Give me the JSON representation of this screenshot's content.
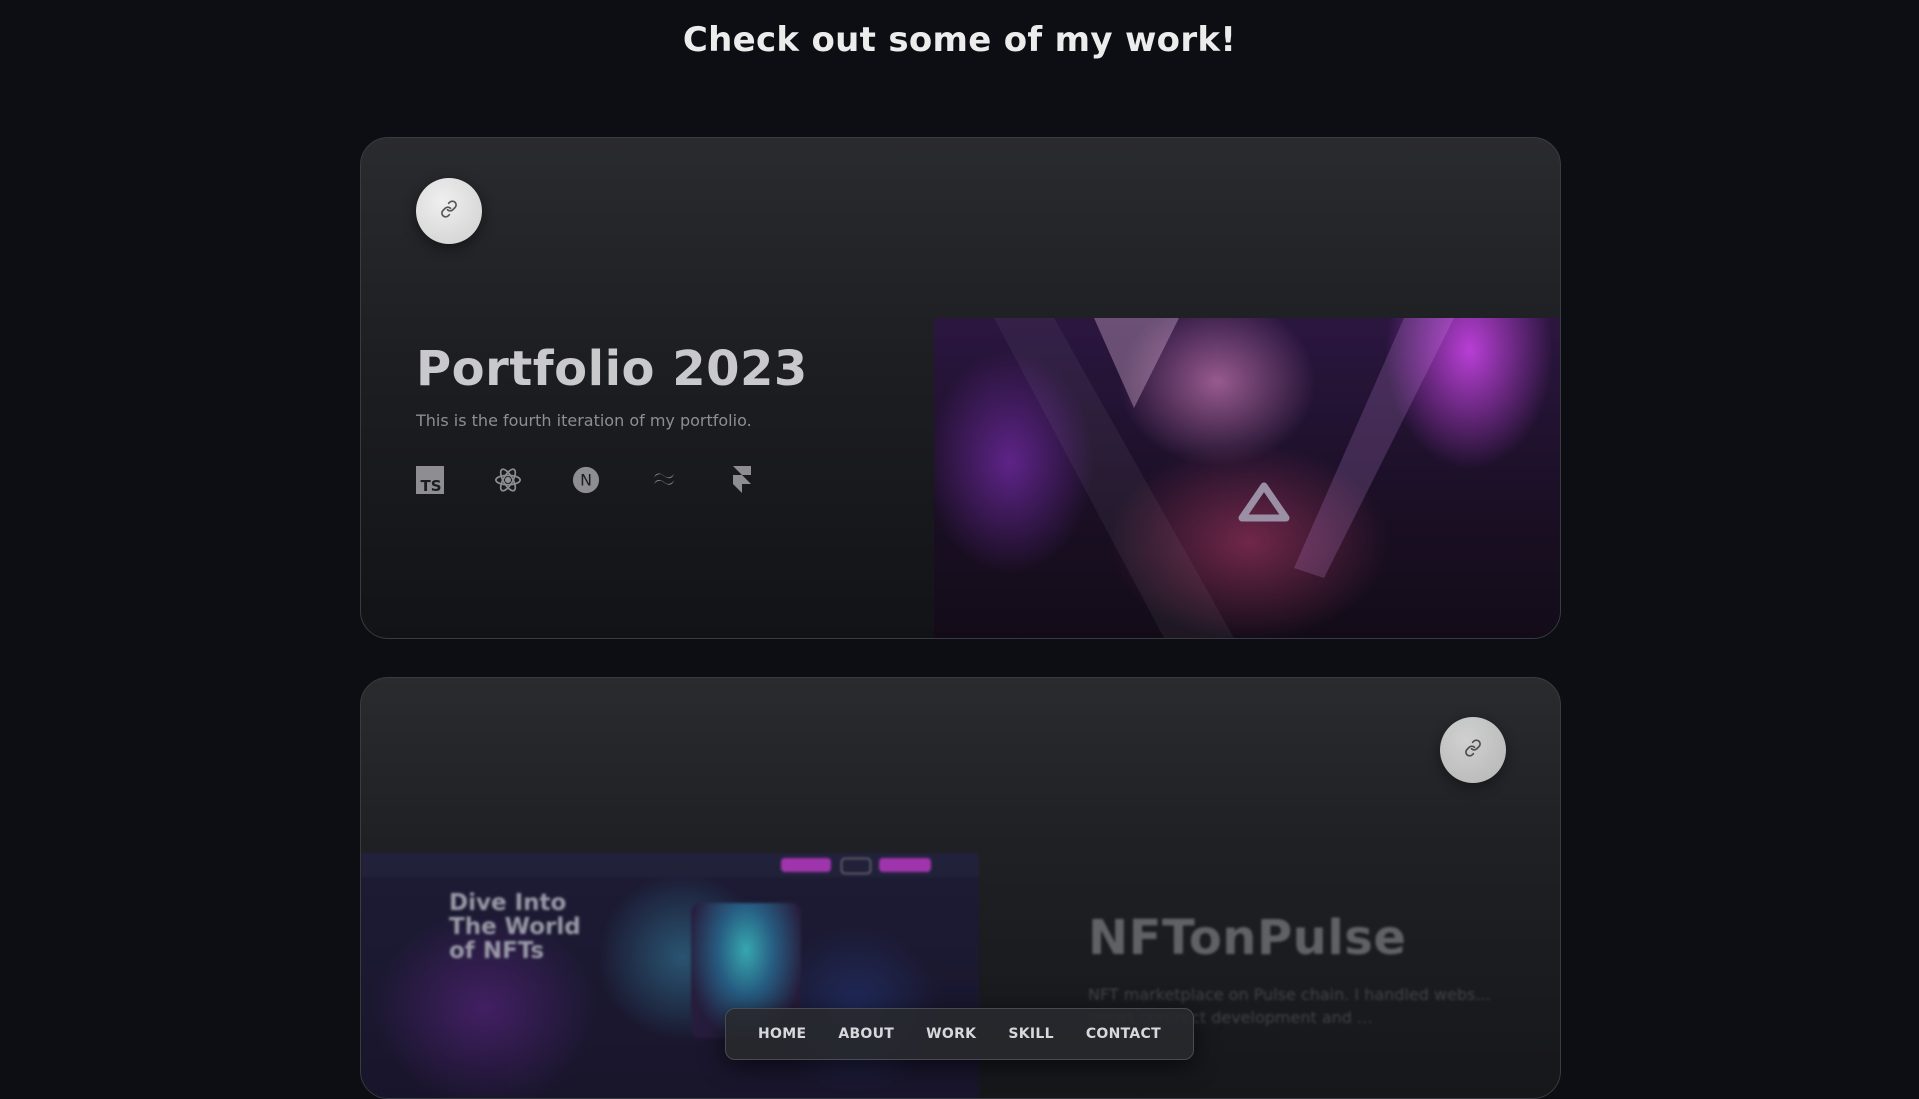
{
  "page": {
    "heading": "Check out some of my work!"
  },
  "projects": [
    {
      "title": "Portfolio 2023",
      "description": "This is the fourth iteration of my portfolio.",
      "tech_icons": [
        "typescript-icon",
        "react-icon",
        "nextjs-icon",
        "tailwind-icon",
        "framer-icon"
      ],
      "tech_labels": {
        "typescript": "TS",
        "nextjs": "N"
      }
    },
    {
      "title": "NFTonPulse",
      "description": "NFT marketplace on Pulse chain. I handled webs... smart contract development and ...",
      "preview": {
        "heading_lines": [
          "Dive Into",
          "The World",
          "of NFTs"
        ]
      }
    }
  ],
  "nav": {
    "items": [
      "HOME",
      "ABOUT",
      "WORK",
      "SKILL",
      "CONTACT"
    ]
  },
  "colors": {
    "background": "#0d0e13",
    "card": "#1f2024",
    "link_button": "#e0e0e0",
    "accent_purple": "#c44cf0"
  }
}
